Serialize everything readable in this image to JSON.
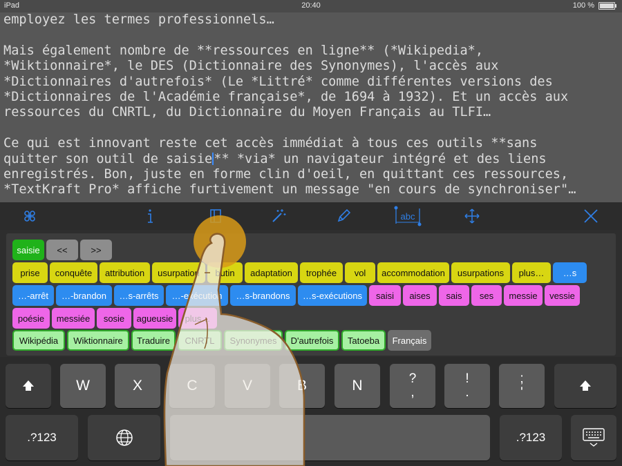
{
  "status_bar": {
    "device": "iPad",
    "time": "20:40",
    "battery": "100 %"
  },
  "editor": {
    "lines": [
      "employez les termes professionnels…",
      "",
      "Mais également nombre de **ressources en ligne** (*Wikipedia*,",
      "*Wiktionnaire*, le DES (Dictionnaire des Synonymes), l'accès aux",
      "*Dictionnaires d'autrefois* (Le *Littré* comme différentes versions des",
      "*Dictionnaires de l'Académie française*, de 1694 à 1932). Et un accès aux",
      "ressources du CNRTL, du Dictionnaire du Moyen Français au TLFI…",
      "",
      "Ce qui est innovant reste cet accès immédiat à tous ces outils **sans",
      "quitter son outil de saisie** *via* un navigateur intégré et des liens",
      "enregistrés. Bon, juste en forme clin d'oeil, en quittant ces ressources,",
      "*TextKraft Pro* affiche furtivement un message \"en cours de synchroniser\"…"
    ],
    "caret_line_before": "quitter son outil de saisie",
    "caret_line_after": "** *via* un navigateur intégré et des liens"
  },
  "toolbar": {
    "icons": [
      "command-icon",
      "info-icon",
      "book-icon",
      "magic-wand-icon",
      "pencil-icon",
      "abc-selection-icon",
      "move-icon",
      "close-icon"
    ],
    "abc_label": "abc",
    "accent": "#2f7fe6"
  },
  "suggestions": {
    "row0": [
      "saisie",
      "<<",
      ">>"
    ],
    "row1": [
      "prise",
      "conquête",
      "attribution",
      "usurpation",
      "butin",
      "adaptation",
      "trophée",
      "vol",
      "accommodation",
      "usurpations",
      "plus…",
      "…s"
    ],
    "row2": [
      "…-arrêt",
      "…-brandon",
      "…s-arrêts",
      "…-exécution",
      "…s-brandons",
      "…s-exécutions",
      "saisi",
      "aises",
      "sais",
      "ses",
      "messie",
      "vessie"
    ],
    "row3": [
      "poésie",
      "messiée",
      "sosie",
      "agueusie",
      "plus…"
    ],
    "row4": [
      "Wikipédia",
      "Wiktionnaire",
      "Traduire",
      "CNRTL",
      "Synonymes",
      "D'autrefois",
      "Tatoeba",
      "Français"
    ],
    "colors": {
      "green": "#20b21a",
      "yellow": "#d8d612",
      "blue": "#2d8cf0",
      "pink": "#ee66e8",
      "light_green": "#a6f0a2",
      "gray": "#6d6d6d"
    }
  },
  "keyboard": {
    "row1": [
      "W",
      "X",
      "C",
      "V",
      "B",
      "N",
      "?\n,",
      "!\n.",
      ";\n'"
    ],
    "numbers_left": ".?123",
    "numbers_right": ".?123"
  }
}
